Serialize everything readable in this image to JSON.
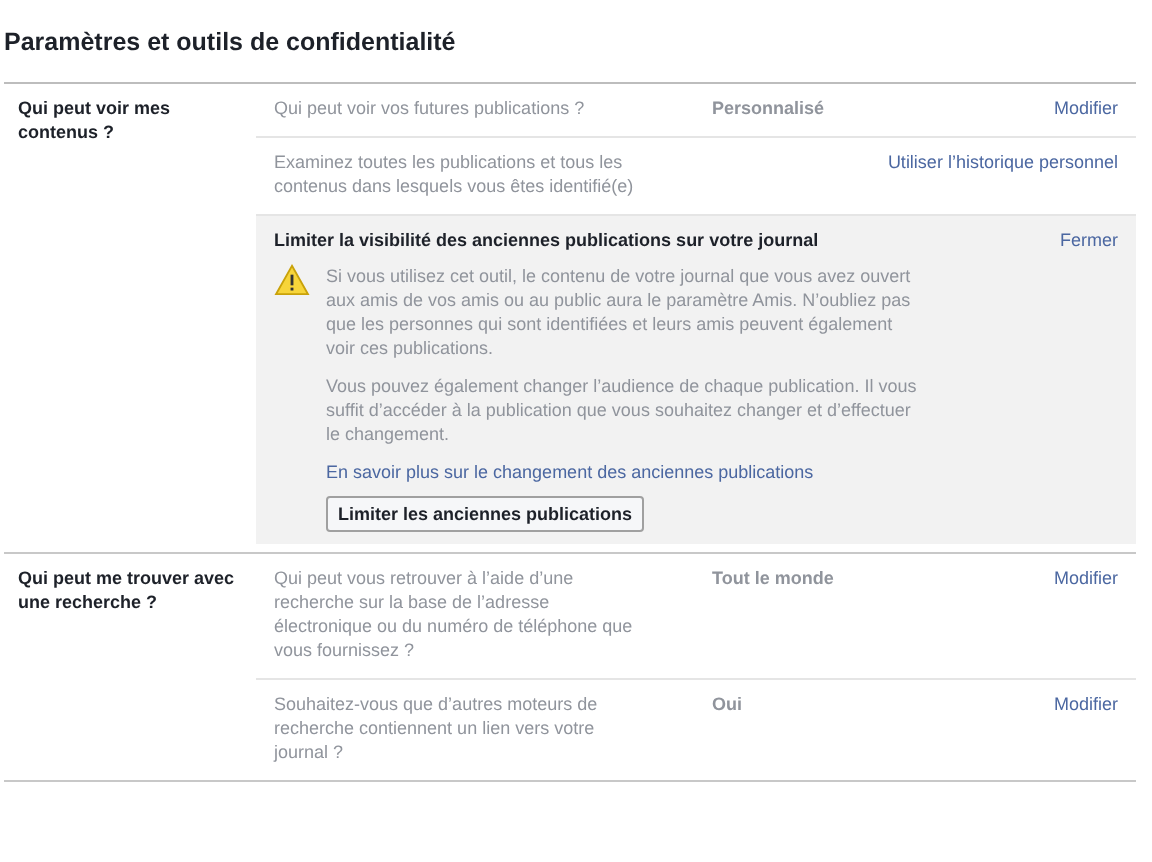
{
  "title": "Paramètres et outils de confidentialité",
  "sections": [
    {
      "label": "Qui peut voir mes contenus ?",
      "rows": [
        {
          "kind": "setting",
          "question": "Qui peut voir vos futures publications ?",
          "value": "Personnalisé",
          "action": "Modifier"
        },
        {
          "kind": "setting",
          "question": "Examinez toutes les publications et tous les contenus dans lesquels vous êtes identifié(e)",
          "action": "Utiliser l’historique personnel"
        },
        {
          "kind": "panel",
          "title": "Limiter la visibilité des anciennes publications sur votre journal",
          "close": "Fermer",
          "paragraphs": [
            "Si vous utilisez cet outil, le contenu de votre journal que vous avez ouvert aux amis de vos amis ou au public aura le paramètre Amis. N’oubliez pas que les personnes qui sont identifiées et leurs amis peuvent également voir ces publications.",
            "Vous pouvez également changer l’audience de chaque publication. Il vous suffit d’accéder à la publication que vous souhaitez changer et d’effectuer le changement."
          ],
          "link": "En savoir plus sur le changement des anciennes publications",
          "button": "Limiter les anciennes publications"
        }
      ]
    },
    {
      "label": "Qui peut me trouver avec une recherche ?",
      "rows": [
        {
          "kind": "setting",
          "question": "Qui peut vous retrouver à l’aide d’une recherche sur la base de l’adresse électronique ou du numéro de téléphone que vous fournissez ?",
          "value": "Tout le monde",
          "action": "Modifier"
        },
        {
          "kind": "setting",
          "question": "Souhaitez-vous que d’autres moteurs de recherche contiennent un lien vers votre journal ?",
          "value": "Oui",
          "action": "Modifier"
        }
      ]
    }
  ]
}
